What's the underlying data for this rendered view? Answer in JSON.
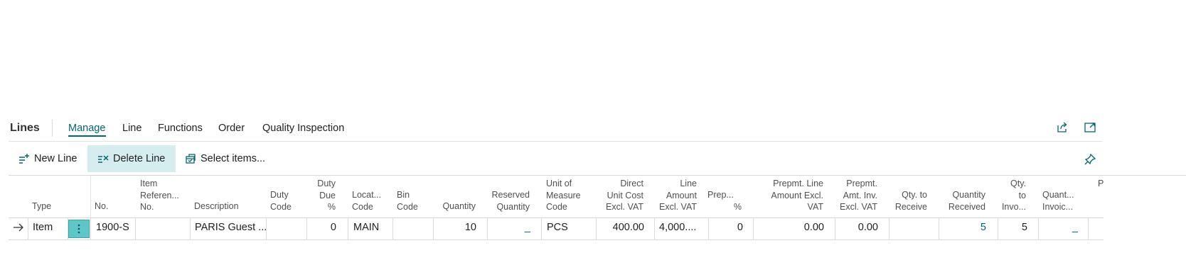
{
  "header": {
    "title": "Lines",
    "tabs": [
      "Manage",
      "Line",
      "Functions",
      "Order",
      "Quality Inspection"
    ],
    "active_tab": "Manage"
  },
  "actions": {
    "new_line": "New Line",
    "delete_line": "Delete Line",
    "select_items": "Select items..."
  },
  "icons": {
    "share": "share-icon",
    "expand": "expand-icon",
    "pin": "pin-icon",
    "row_arrow": "arrow-right-icon",
    "row_menu": "more-vertical-icon"
  },
  "colors": {
    "accent": "#00666f",
    "highlight": "#d6edef",
    "selected_cell": "#5ec6c9"
  },
  "columns": {
    "type": [
      "Type"
    ],
    "no": [
      "No."
    ],
    "item_ref": [
      "Item",
      "Referen...",
      "No."
    ],
    "description": [
      "Description"
    ],
    "duty_code": [
      "Duty",
      "Code"
    ],
    "duty_due": [
      "Duty",
      "Due",
      "%"
    ],
    "location": [
      "Locat...",
      "Code"
    ],
    "bin": [
      "Bin",
      "Code"
    ],
    "quantity": [
      "Quantity"
    ],
    "reserved": [
      "Reserved",
      "Quantity"
    ],
    "uom": [
      "Unit of",
      "Measure",
      "Code"
    ],
    "direct_cost": [
      "Direct",
      "Unit Cost",
      "Excl. VAT"
    ],
    "line_amount": [
      "Line",
      "Amount",
      "Excl. VAT"
    ],
    "prep": [
      "Prep...",
      "%"
    ],
    "prepmt_line": [
      "Prepmt. Line",
      "Amount Excl.",
      "VAT"
    ],
    "prepmt_inv": [
      "Prepmt.",
      "Amt. Inv.",
      "Excl. VAT"
    ],
    "qty_receive": [
      "Qty. to",
      "Receive"
    ],
    "qty_received": [
      "Quantity",
      "Received"
    ],
    "qty_invoice": [
      "Qty.",
      "to",
      "Invo..."
    ],
    "qty_invoiced": [
      "Quant...",
      "Invoic..."
    ],
    "cut": [
      "P"
    ]
  },
  "row": {
    "type": "Item",
    "no": "1900-S",
    "item_ref": "",
    "description": "PARIS Guest ...",
    "duty_code": "",
    "duty_due": "0",
    "location": "MAIN",
    "bin": "",
    "quantity": "10",
    "reserved": "_",
    "uom": "PCS",
    "direct_cost": "400.00",
    "line_amount": "4,000....",
    "prep": "0",
    "prepmt_line": "0.00",
    "prepmt_inv": "0.00",
    "qty_receive": "",
    "qty_received": "5",
    "qty_invoice": "5",
    "qty_invoiced": "_"
  }
}
